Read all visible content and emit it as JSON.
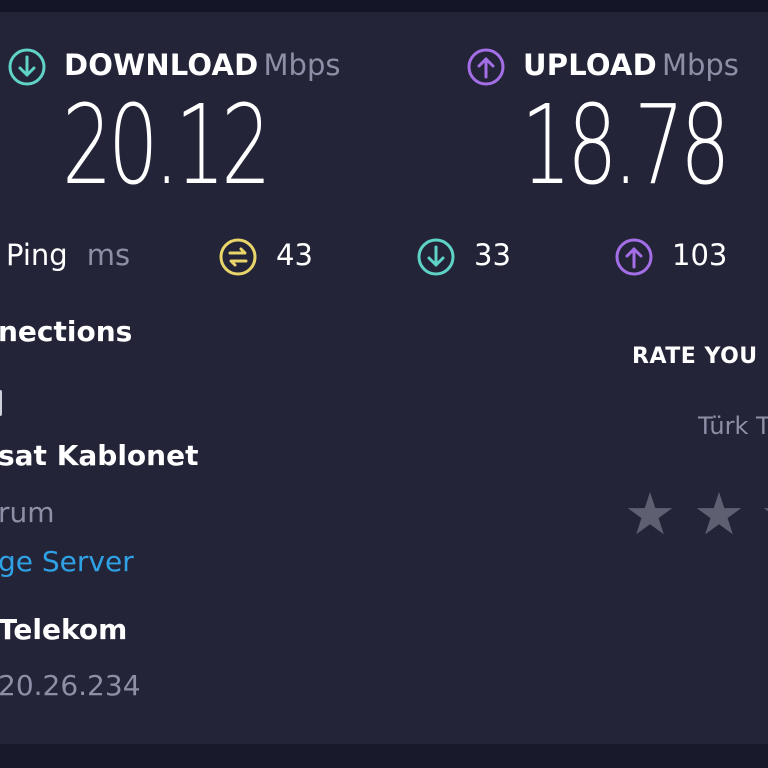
{
  "download": {
    "label": "DOWNLOAD",
    "unit": "Mbps",
    "value": "20.12",
    "color": "#5fd3c6"
  },
  "upload": {
    "label": "UPLOAD",
    "unit": "Mbps",
    "value": "18.78",
    "color": "#a46ee6"
  },
  "ping": {
    "label": "Ping",
    "unit": "ms",
    "unloaded": "43",
    "download": "33",
    "upload": "103",
    "unloaded_color": "#ead56a"
  },
  "connections": {
    "title": "nections",
    "mode": "",
    "isp_name": "sat Kablonet",
    "location": "rum",
    "change_server": "ge Server",
    "server_name": "Telekom",
    "ip": "20.26.234"
  },
  "rating": {
    "title": "RATE YOU",
    "provider": "Türk T",
    "star_count_visible": 3
  }
}
